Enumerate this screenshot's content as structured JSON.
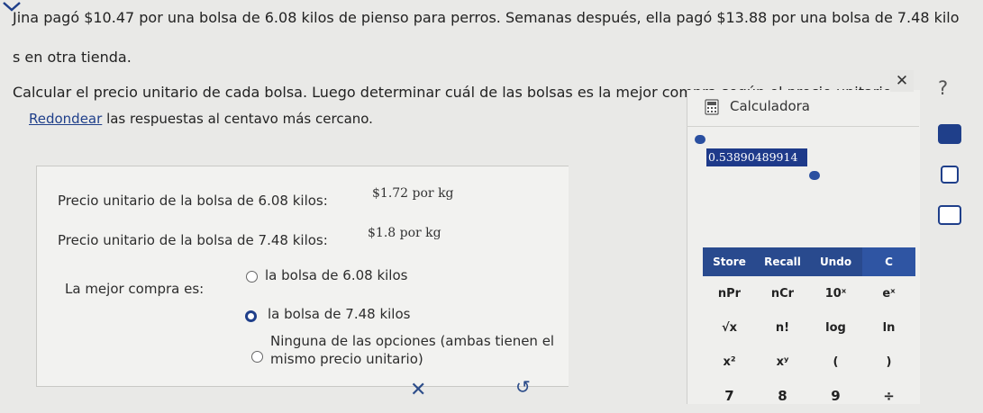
{
  "problem": {
    "line1": "Jina pagó $10.47 por una bolsa de 6.08 kilos de pienso para perros. Semanas después, ella pagó $13.88 por una bolsa de 7.48 kilo",
    "line2": "s en otra tienda.",
    "instruction": "Calcular el precio unitario de cada bolsa. Luego determinar cuál de las bolsas es la mejor compra según el precio unitario.",
    "round_link": "Redondear",
    "round_rest": " las respuestas al centavo más cercano."
  },
  "answers": {
    "unit_price_1_label": "Precio unitario de la bolsa de 6.08 kilos:",
    "unit_price_1_value": "$1.72 por kg",
    "unit_price_2_label": "Precio unitario de la bolsa de 7.48 kilos:",
    "unit_price_2_value": "$1.8 por kg",
    "best_buy_label": "La mejor compra es:",
    "options": [
      {
        "text": "la bolsa de 6.08 kilos",
        "selected": false
      },
      {
        "text": "la bolsa de 7.48 kilos",
        "selected": true
      },
      {
        "text": "Ninguna de las opciones (ambas tienen el",
        "selected": false
      },
      {
        "text": "mismo precio unitario)",
        "selected": false
      }
    ]
  },
  "footer": {
    "clear": "✕",
    "undo": "↺"
  },
  "calculator": {
    "title": "Calculadora",
    "close": "✕",
    "help": "?",
    "display": "0.53890489914",
    "keys": {
      "row0": [
        "Store",
        "Recall",
        "Undo",
        "C"
      ],
      "row1": [
        "nPr",
        "nCr",
        "10ˣ",
        "eˣ"
      ],
      "row2": [
        "√x",
        "n!",
        "log",
        "ln"
      ],
      "row3": [
        "x²",
        "xʸ",
        "(",
        ")"
      ],
      "row4": [
        "7",
        "8",
        "9",
        "÷"
      ]
    }
  },
  "colors": {
    "accent": "#1e3a8a",
    "selected_radio": "#1f3f8a"
  }
}
